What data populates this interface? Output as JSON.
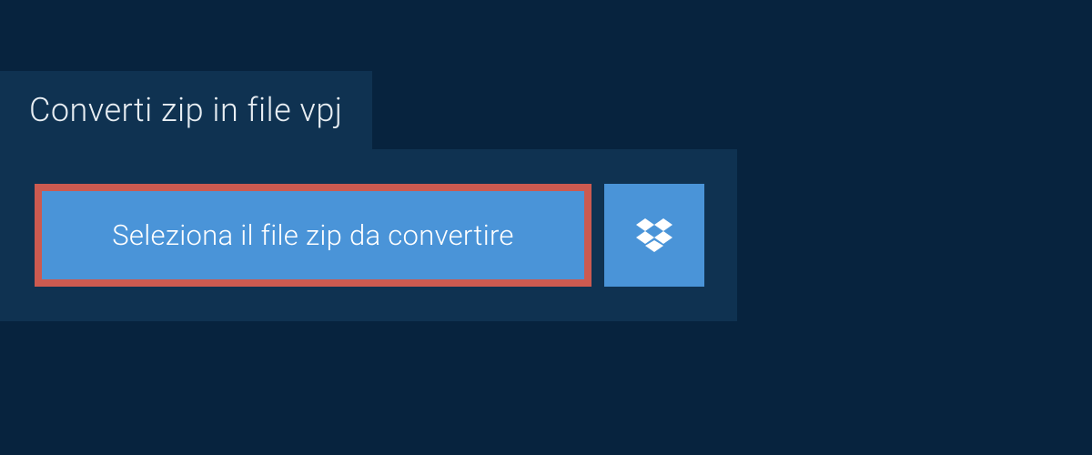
{
  "tab": {
    "title": "Converti zip in file vpj"
  },
  "buttons": {
    "select_file_label": "Seleziona il file zip da convertire"
  },
  "colors": {
    "background": "#07233e",
    "panel": "#0f3251",
    "button": "#4a94d8",
    "highlight_border": "#cc5a50",
    "text": "#ffffff"
  }
}
